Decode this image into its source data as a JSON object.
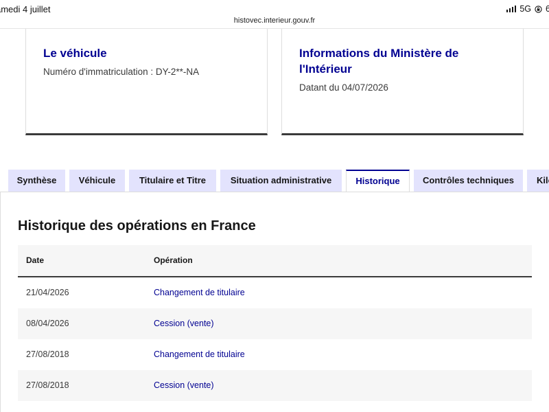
{
  "status_bar": {
    "time_text": "amedi 4 juillet",
    "network": "5G",
    "battery_partial": "6",
    "url": "histovec.interieur.gouv.fr"
  },
  "cards": {
    "vehicle": {
      "title": "Le véhicule",
      "registration": "Numéro d'immatriculation : DY-2**-NA"
    },
    "ministry": {
      "title": "Informations du Ministère de l'Intérieur",
      "date_text": "Datant du 04/07/2026"
    }
  },
  "tabs": [
    {
      "label": "Synthèse",
      "active": false
    },
    {
      "label": "Véhicule",
      "active": false
    },
    {
      "label": "Titulaire et Titre",
      "active": false
    },
    {
      "label": "Situation administrative",
      "active": false
    },
    {
      "label": "Historique",
      "active": true
    },
    {
      "label": "Contrôles techniques",
      "active": false
    },
    {
      "label": "Kilo",
      "active": false
    }
  ],
  "history": {
    "title": "Historique des opérations en France",
    "columns": {
      "date": "Date",
      "operation": "Opération"
    },
    "rows": [
      {
        "date": "21/04/2026",
        "operation": "Changement de titulaire"
      },
      {
        "date": "08/04/2026",
        "operation": "Cession (vente)"
      },
      {
        "date": "27/08/2018",
        "operation": "Changement de titulaire"
      },
      {
        "date": "27/08/2018",
        "operation": "Cession (vente)"
      }
    ]
  },
  "colors": {
    "primary": "#000091",
    "tab_bg": "#e3e3fd",
    "row_alt": "#f6f6f6"
  }
}
